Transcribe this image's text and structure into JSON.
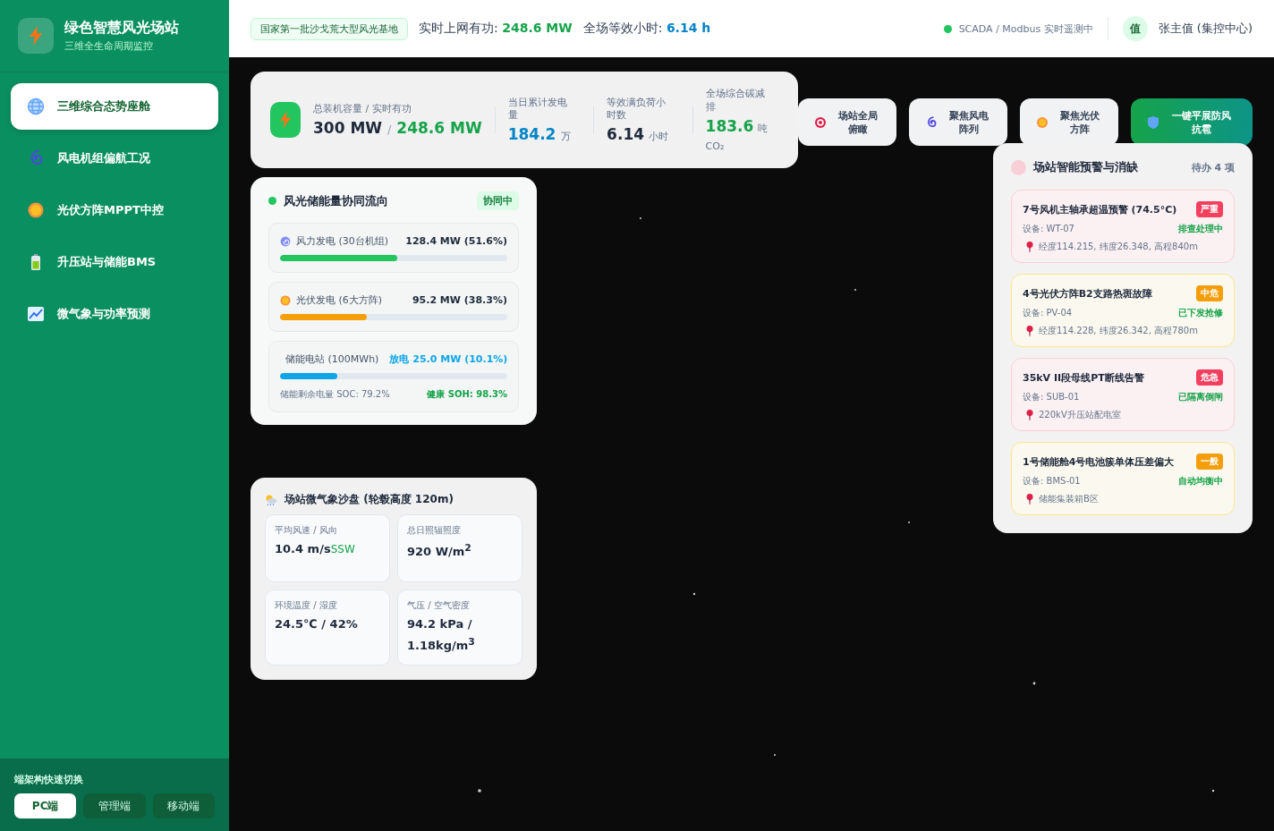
{
  "brand": {
    "title": "绿色智慧风光场站",
    "subtitle": "三维全生命周期监控"
  },
  "nav": [
    {
      "label": "三维综合态势座舱",
      "selected": true
    },
    {
      "label": "风电机组偏航工况",
      "selected": false
    },
    {
      "label": "光伏方阵MPPT中控",
      "selected": false
    },
    {
      "label": "升压站与储能BMS",
      "selected": false
    },
    {
      "label": "微气象与功率预测",
      "selected": false
    }
  ],
  "switcher": {
    "title": "端架构快速切换",
    "options": [
      {
        "label": "PC端",
        "selected": true
      },
      {
        "label": "管理端",
        "selected": false
      },
      {
        "label": "移动端",
        "selected": false
      }
    ]
  },
  "header": {
    "badge": "国家第一批沙戈荒大型风光基地",
    "metrics": [
      {
        "label": "实时上网有功:",
        "value": "248.6 MW",
        "color": "#16a34a"
      },
      {
        "label": "全场等效小时:",
        "value": "6.14 h",
        "color": "#0284c7"
      }
    ],
    "status": {
      "online": true,
      "text": "SCADA / Modbus 实时遥测中"
    },
    "user": {
      "avatar": "值",
      "name": "张主值 (集控中心)"
    }
  },
  "stats": {
    "capacity": {
      "label": "总装机容量 / 实时有功",
      "total": "300 MW",
      "sep": "/",
      "active": "248.6 MW"
    },
    "items": [
      {
        "label": "当日累计发电量",
        "value": "184.2",
        "unit": "万",
        "color": "#0284c7"
      },
      {
        "label": "等效满负荷小时数",
        "value": "6.14",
        "unit": "小时",
        "color": "#1e293b"
      },
      {
        "label": "全场综合碳减排",
        "value": "183.6",
        "unit": "吨",
        "note": "CO₂",
        "color": "#16a34a"
      }
    ]
  },
  "views": [
    {
      "label": "场站全局俯瞰",
      "kind": "normal"
    },
    {
      "label": "聚焦风电阵列",
      "kind": "normal"
    },
    {
      "label": "聚焦光伏方阵",
      "kind": "normal"
    },
    {
      "label": "一键平展防风抗雹",
      "kind": "primary"
    }
  ],
  "flow": {
    "title": "风光储能量协同流向",
    "badge": "协同中",
    "rows": [
      {
        "label": "风力发电 (30台机组)",
        "reading": "128.4 MW (51.6%)",
        "level": 0.516,
        "color": "#22c55e"
      },
      {
        "label": "光伏发电 (6大方阵)",
        "reading": "95.2 MW (38.3%)",
        "level": 0.383,
        "color": "#f59e0b"
      },
      {
        "label": "储能电站 (100MWh)",
        "reading": "放电 25.0 MW (10.1%)",
        "level": 0.25,
        "color": "#0ea5e9",
        "soc": "储能剩余电量 SOC: 79.2%",
        "soh": "健康 SOH: 98.3%"
      }
    ]
  },
  "weather": {
    "title": "场站微气象沙盘 (轮毂高度 120m)",
    "cells": [
      {
        "label": "平均风速 / 风向",
        "value": "10.4 m/s",
        "extra": "SSW"
      },
      {
        "label": "总日照辐照度",
        "value": "920 W/m$^{2}$"
      },
      {
        "label": "环境温度 / 湿度",
        "value": "24.5℃ / 42%"
      },
      {
        "label": "气压 / 空气密度",
        "value": "94.2 kPa / 1.18kg/m$^{3}$"
      }
    ]
  },
  "alerts": {
    "title": "场站智能预警与消缺",
    "count": "待办 4 项",
    "items": [
      {
        "title": "7号风机主轴承超温预警 (74.5°C)",
        "badge": "严重",
        "kind": "critical",
        "device": "设备: WT-07",
        "status": "排查处理中",
        "location": "经度114.215, 纬度26.348, 高程840m"
      },
      {
        "title": "4号光伏方阵B2支路热斑故障",
        "badge": "中危",
        "kind": "warning",
        "device": "设备: PV-04",
        "status": "已下发抢修",
        "location": "经度114.228, 纬度26.342, 高程780m"
      },
      {
        "title": "35kV II段母线PT断线告警",
        "badge": "危急",
        "kind": "critical",
        "device": "设备: SUB-01",
        "status": "已隔离倒闸",
        "location": "220kV升压站配电室"
      },
      {
        "title": "1号储能舱4号电池簇单体压差偏大",
        "badge": "一般",
        "kind": "warning",
        "device": "设备: BMS-01",
        "status": "自动均衡中",
        "location": "储能集装箱B区"
      }
    ]
  }
}
